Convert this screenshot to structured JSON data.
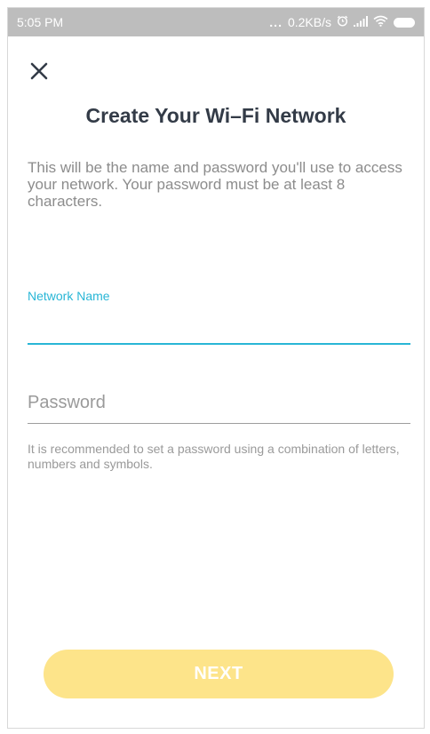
{
  "status_bar": {
    "time": "5:05 PM",
    "dots": "...",
    "speed": "0.2KB/s"
  },
  "page": {
    "title": "Create Your Wi–Fi Network",
    "description": "This will be the name and password you'll use to access your network. Your password must be at least 8 characters."
  },
  "form": {
    "network_name": {
      "label": "Network Name",
      "value": ""
    },
    "password": {
      "placeholder": "Password",
      "value": ""
    },
    "hint": "It is recommended to set a password using a combination of letters, numbers and symbols."
  },
  "actions": {
    "next_label": "NEXT"
  },
  "colors": {
    "accent": "#29b6d6",
    "button_disabled": "#fde48a",
    "title": "#333b47",
    "status_bar_bg": "#bdbdbd"
  }
}
